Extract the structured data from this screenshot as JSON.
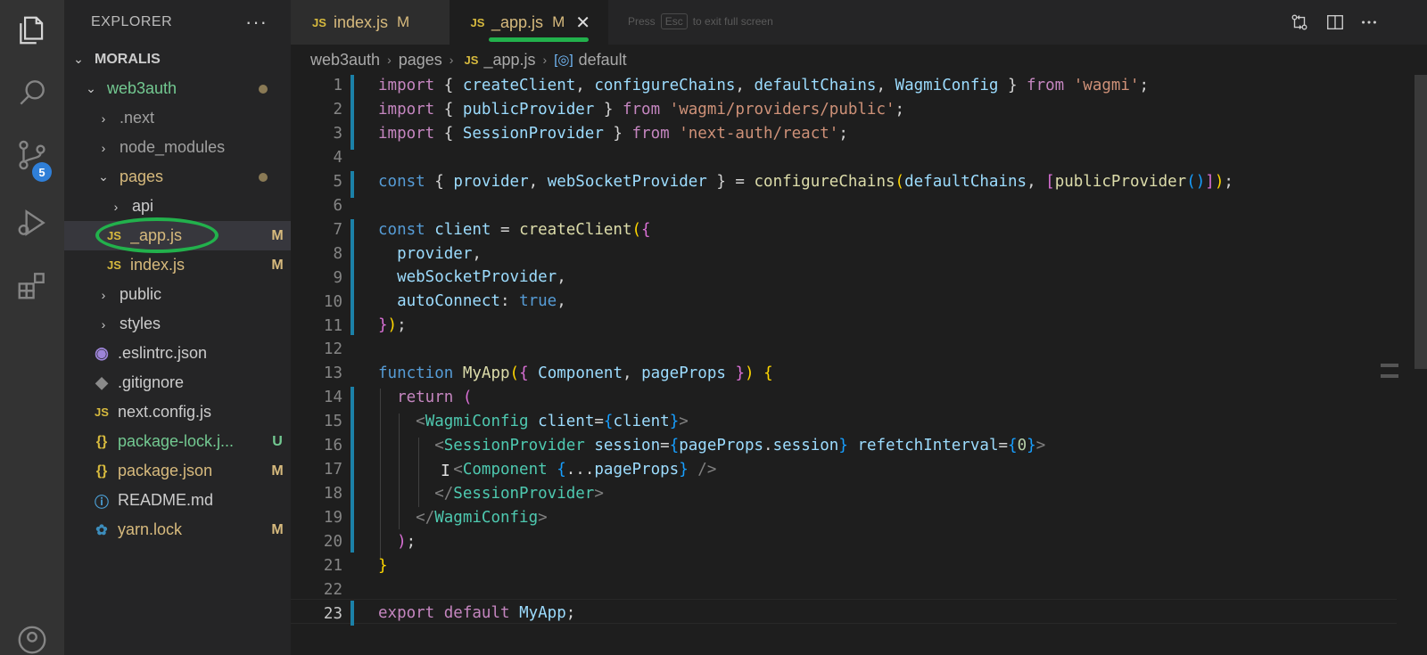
{
  "explorer": {
    "title": "EXPLORER",
    "more": "···",
    "root": "MORALIS",
    "items": [
      {
        "label": "web3auth",
        "status": ""
      },
      {
        "label": ".next",
        "status": ""
      },
      {
        "label": "node_modules",
        "status": ""
      },
      {
        "label": "pages",
        "status": ""
      },
      {
        "label": "api",
        "status": ""
      },
      {
        "label": "_app.js",
        "status": "M",
        "icon": "JS"
      },
      {
        "label": "index.js",
        "status": "M",
        "icon": "JS"
      },
      {
        "label": "public",
        "status": ""
      },
      {
        "label": "styles",
        "status": ""
      },
      {
        "label": ".eslintrc.json",
        "status": ""
      },
      {
        "label": ".gitignore",
        "status": ""
      },
      {
        "label": "next.config.js",
        "status": "",
        "icon": "JS"
      },
      {
        "label": "package-lock.j...",
        "status": "U",
        "icon": "{}"
      },
      {
        "label": "package.json",
        "status": "M",
        "icon": "{}"
      },
      {
        "label": "README.md",
        "status": ""
      },
      {
        "label": "yarn.lock",
        "status": "M"
      }
    ]
  },
  "activity": {
    "scm_badge": "5",
    "icons": [
      "files-icon",
      "search-icon",
      "source-control-icon",
      "run-debug-icon",
      "extensions-icon",
      "account-icon"
    ]
  },
  "tabs": [
    {
      "icon": "JS",
      "label": "index.js",
      "status": "M"
    },
    {
      "icon": "JS",
      "label": "_app.js",
      "status": "M",
      "close": "✕"
    }
  ],
  "fullscreen_hint": {
    "press": "Press",
    "key": "Esc",
    "rest": "to exit full screen"
  },
  "breadcrumb": {
    "parts": [
      "web3auth",
      "pages",
      "_app.js",
      "default"
    ],
    "file_icon": "JS"
  },
  "editor": {
    "line_numbers": [
      "1",
      "2",
      "3",
      "4",
      "5",
      "6",
      "7",
      "8",
      "9",
      "10",
      "11",
      "12",
      "13",
      "14",
      "15",
      "16",
      "17",
      "18",
      "19",
      "20",
      "21",
      "22",
      "23"
    ],
    "current_line": "23"
  },
  "colors": {
    "accent_ring": "#22b14c",
    "modified": "#d7ba7d",
    "untracked": "#73c991",
    "badge": "#2f7fd8"
  }
}
